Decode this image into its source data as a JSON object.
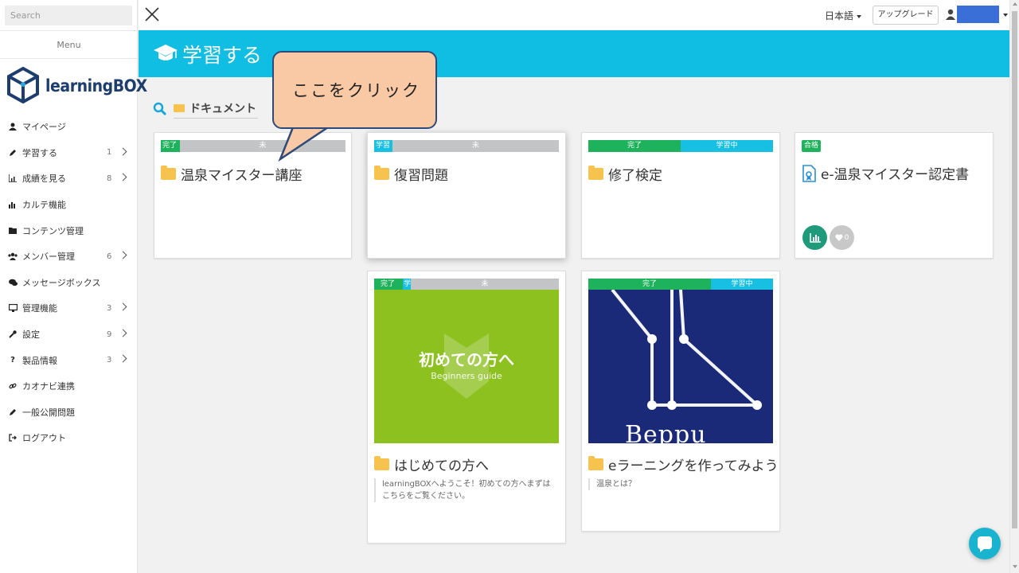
{
  "sidebar": {
    "search_placeholder": "Search",
    "menu_title": "Menu",
    "logo_text": "learningBOX",
    "items": [
      {
        "label": "マイページ",
        "icon": "user-icon",
        "count": ""
      },
      {
        "label": "学習する",
        "icon": "pencil-icon",
        "count": "1"
      },
      {
        "label": "成績を見る",
        "icon": "chart-icon",
        "count": "8"
      },
      {
        "label": "カルテ機能",
        "icon": "bar-chart-icon",
        "count": ""
      },
      {
        "label": "コンテンツ管理",
        "icon": "folder-icon",
        "count": ""
      },
      {
        "label": "メンバー管理",
        "icon": "users-icon",
        "count": "6"
      },
      {
        "label": "メッセージボックス",
        "icon": "comments-icon",
        "count": ""
      },
      {
        "label": "管理機能",
        "icon": "monitor-icon",
        "count": "3"
      },
      {
        "label": "設定",
        "icon": "wrench-icon",
        "count": "9"
      },
      {
        "label": "製品情報",
        "icon": "question-icon",
        "count": "3"
      },
      {
        "label": "カオナビ連携",
        "icon": "link-icon",
        "count": ""
      },
      {
        "label": "一般公開問題",
        "icon": "pencil-icon",
        "count": ""
      },
      {
        "label": "ログアウト",
        "icon": "logout-icon",
        "count": ""
      }
    ]
  },
  "topbar": {
    "language": "日本語",
    "upgrade_label": "アップグレード"
  },
  "header": {
    "title": "学習する"
  },
  "breadcrumb": {
    "label": "ドキュメント"
  },
  "callout": {
    "text": "ここをクリック"
  },
  "cards": [
    {
      "title": "温泉マイスター講座",
      "status": [
        "完了",
        "未"
      ]
    },
    {
      "title": "復習問題",
      "status": [
        "学習",
        "未"
      ]
    },
    {
      "title": "修了検定",
      "status": [
        "完了",
        "学習中"
      ]
    },
    {
      "title": "e-温泉マイスター認定書",
      "badge": "合格",
      "like_count": "0"
    },
    {
      "title": "はじめての方へ",
      "status": [
        "完了",
        "学",
        "未"
      ],
      "thumb_title": "初めての方へ",
      "thumb_subtitle": "Beginners guide",
      "description": "learningBOXへようこそ！初めての方へまずはこちらをご覧ください。"
    },
    {
      "title": "eラーニングを作ってみよう",
      "status": [
        "完了",
        "学習中"
      ],
      "thumb_text": "Beppu",
      "description": "温泉とは？"
    }
  ],
  "colors": {
    "header": "#10bde3",
    "complete": "#1db25b",
    "learning": "#17bfe3",
    "not_started": "#c3c4c6",
    "folder": "#f8c24f"
  }
}
